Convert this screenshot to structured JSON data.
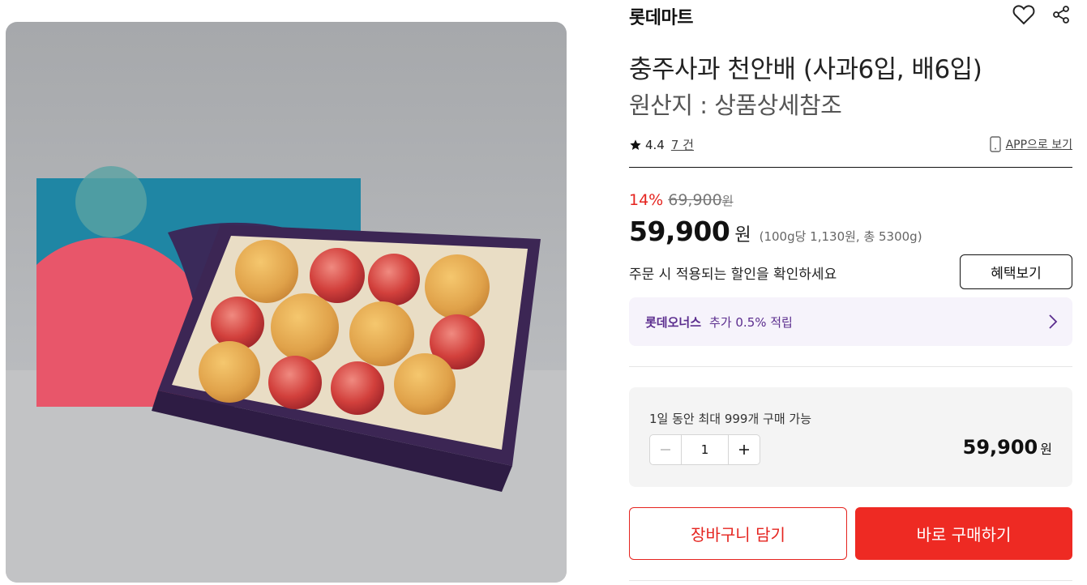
{
  "product_image": {
    "alt": "충주사과 천안배 선물세트"
  },
  "header": {
    "brand": "롯데마트",
    "wishlist_icon": "heart-icon",
    "share_icon": "share-icon"
  },
  "product": {
    "title": "충주사과 천안배 (사과6입, 배6입)",
    "origin": "원산지 : 상품상세참조"
  },
  "rating": {
    "star_icon": "star-icon",
    "score": "4.4",
    "count": "7 건"
  },
  "app_link": {
    "icon": "mobile-phone-icon",
    "label": "APP으로 보기"
  },
  "pricing": {
    "discount_rate": "14%",
    "original_price": "69,900",
    "original_currency": "원",
    "sale_price": "59,900",
    "currency": "원",
    "unit_price": "(100g당 1,130원, 총 5300g)"
  },
  "benefit": {
    "notice": "주문 시 적용되는 할인을 확인하세요",
    "button_label": "혜택보기"
  },
  "membership": {
    "name": "롯데오너스",
    "text": "추가 0.5% 적립",
    "chevron_icon": "chevron-right-icon"
  },
  "quantity": {
    "limit_text": "1일 동안 최대 999개 구매 가능",
    "value": "1",
    "minus_icon": "minus-icon",
    "plus_icon": "plus-icon",
    "total": "59,900",
    "total_currency": "원"
  },
  "actions": {
    "cart_label": "장바구니 담기",
    "buy_label": "바로 구매하기"
  },
  "colors": {
    "accent_red": "#ee2a23",
    "membership_purple": "#5b2d8e",
    "membership_bg": "#f6f3fb"
  }
}
